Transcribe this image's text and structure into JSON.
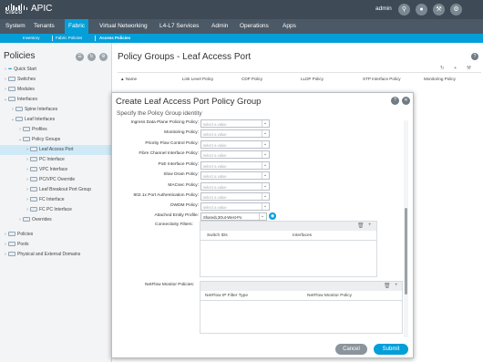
{
  "colors": {
    "accent": "#049fd9",
    "header_bg": "#3e4a56",
    "nav_bg": "#4b5865"
  },
  "header": {
    "logo_text": "CISCO",
    "app_title": "APIC",
    "user": "admin",
    "icons": [
      "search-icon",
      "bell-icon",
      "tools-icon",
      "gear-icon"
    ]
  },
  "main_nav": [
    "System",
    "Tenants",
    "Fabric",
    "Virtual Networking",
    "L4-L7 Services",
    "Admin",
    "Operations",
    "Apps"
  ],
  "main_nav_active": "Fabric",
  "sub_nav": [
    "Inventory",
    "Fabric Policies",
    "Access Policies"
  ],
  "sub_nav_active": "Access Policies",
  "sidebar": {
    "title": "Policies",
    "items": [
      {
        "label": "Quick Start"
      },
      {
        "label": "Switches"
      },
      {
        "label": "Modules"
      },
      {
        "label": "Interfaces"
      },
      {
        "label": "Spine Interfaces"
      },
      {
        "label": "Leaf Interfaces"
      },
      {
        "label": "Profiles"
      },
      {
        "label": "Policy Groups"
      },
      {
        "label": "Leaf Access Port"
      },
      {
        "label": "PC Interface"
      },
      {
        "label": "VPC Interface"
      },
      {
        "label": "PC/VPC Override"
      },
      {
        "label": "Leaf Breakout Port Group"
      },
      {
        "label": "FC Interface"
      },
      {
        "label": "FC PC Interface"
      },
      {
        "label": "Overrides"
      },
      {
        "label": "Policies"
      },
      {
        "label": "Pools"
      },
      {
        "label": "Physical and External Domains"
      }
    ]
  },
  "background_page": {
    "title": "Policy Groups - Leaf Access Port",
    "columns": [
      "Name",
      "Link Level Policy",
      "CDP Policy",
      "LLDP Policy",
      "STP Interface Policy",
      "Monitoring Policy"
    ]
  },
  "modal": {
    "title": "Create Leaf Access Port Policy Group",
    "subtitle": "Specify the Policy Group identity",
    "fields": [
      {
        "label": "Ingress Data Plane Policing Policy:",
        "placeholder": "select a value"
      },
      {
        "label": "Monitoring Policy:",
        "placeholder": "select a value"
      },
      {
        "label": "Priority Flow Control Policy:",
        "placeholder": "select a value"
      },
      {
        "label": "Fibre Channel Interface Policy:",
        "placeholder": "select a value"
      },
      {
        "label": "PoE Interface Policy:",
        "placeholder": "select a value"
      },
      {
        "label": "Slow Drain Policy:",
        "placeholder": "select a value"
      },
      {
        "label": "MACsec Policy:",
        "placeholder": "select a value"
      },
      {
        "label": "802.1x Port Authentication Policy:",
        "placeholder": "select a value"
      },
      {
        "label": "DWDM Policy:",
        "placeholder": "select a value"
      }
    ],
    "aep": {
      "label": "Attached Entity Profile:",
      "value": "SharedL3Out-West-Po"
    },
    "connectivity": {
      "label": "Connectivity Filters:",
      "columns": [
        "Switch IDs",
        "Interfaces"
      ]
    },
    "netflow": {
      "label": "NetFlow Monitor Policies:",
      "columns": [
        "NetFlow IP Filter Type",
        "NetFlow Monitor Policy"
      ]
    },
    "cancel_label": "Cancel",
    "submit_label": "Submit"
  }
}
